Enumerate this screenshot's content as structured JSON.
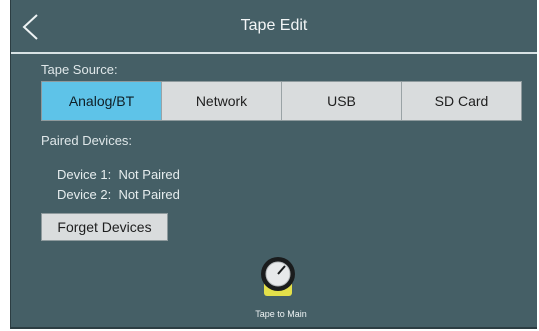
{
  "header": {
    "title": "Tape Edit"
  },
  "tape_source": {
    "label": "Tape Source:",
    "options": [
      "Analog/BT",
      "Network",
      "USB",
      "SD Card"
    ],
    "selected": "Analog/BT"
  },
  "paired": {
    "label": "Paired Devices:",
    "devices": [
      {
        "name": "Device 1:",
        "status": "Not Paired"
      },
      {
        "name": "Device 2:",
        "status": "Not Paired"
      }
    ]
  },
  "forget_button": "Forget Devices",
  "knob": {
    "label": "Tape to Main",
    "accent_color": "#e3e04a"
  },
  "colors": {
    "panel": "#455f66",
    "active": "#5ec3e8",
    "button": "#d9dcdd"
  }
}
